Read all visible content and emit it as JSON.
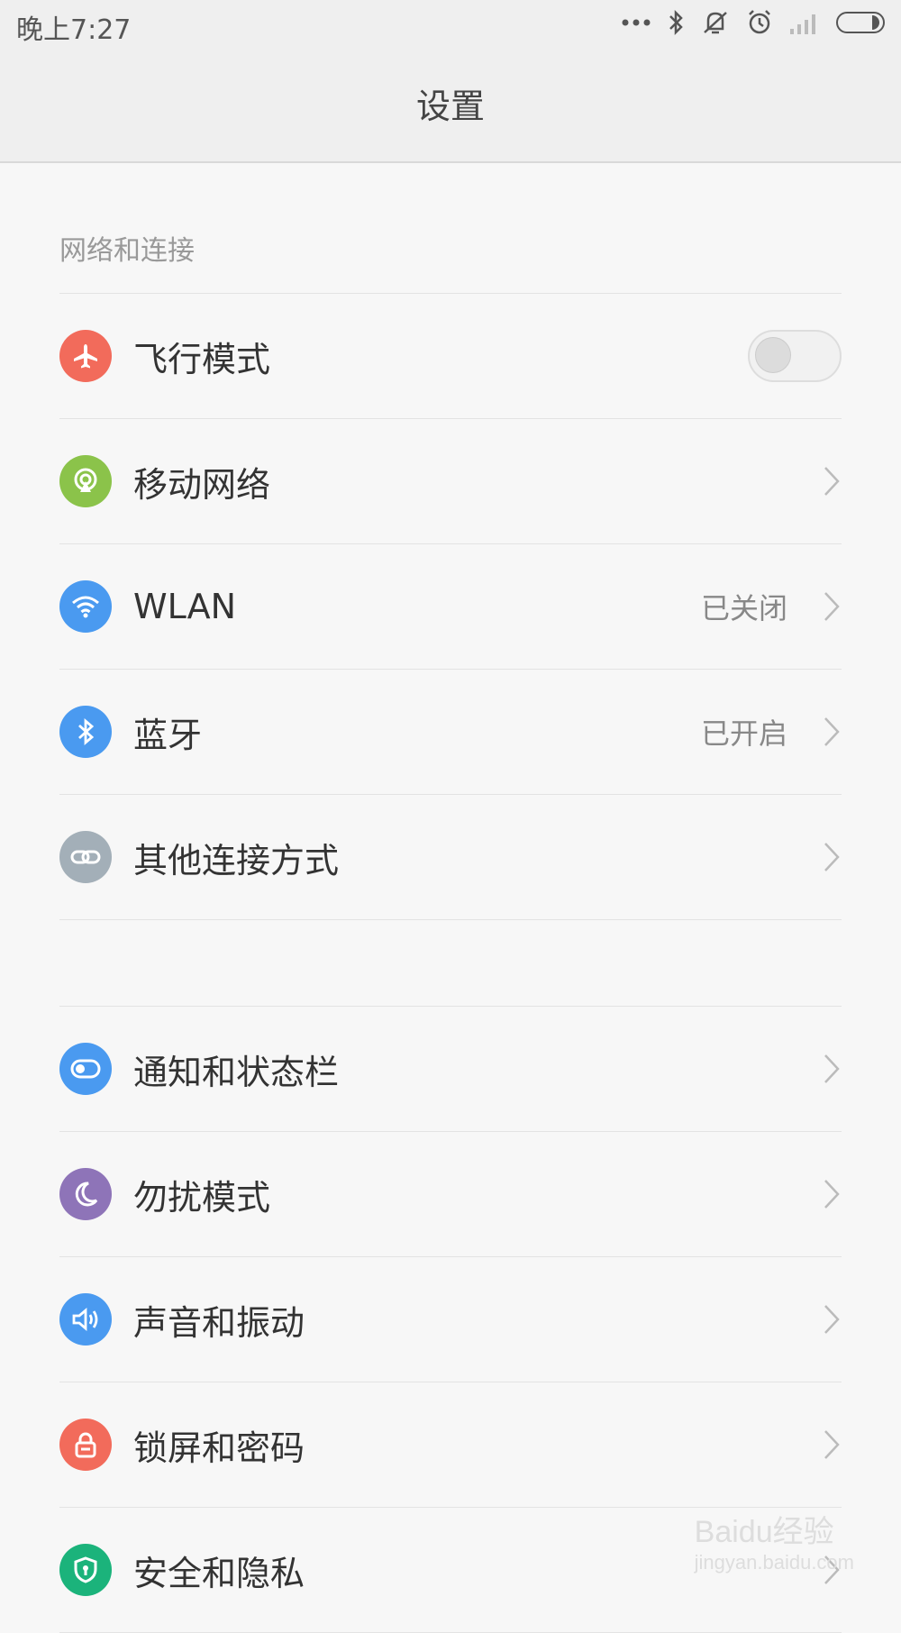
{
  "status_bar": {
    "time": "晚上7:27",
    "icons": [
      "dots-icon",
      "bluetooth-icon",
      "mute-icon",
      "alarm-icon",
      "signal-icon",
      "battery-icon"
    ]
  },
  "header": {
    "title": "设置"
  },
  "section1": {
    "title": "网络和连接",
    "items": [
      {
        "label": "飞行模式",
        "icon": "airplane-icon",
        "color": "#f26b5b",
        "toggle": "off"
      },
      {
        "label": "移动网络",
        "icon": "cellular-icon",
        "color": "#8bc34a"
      },
      {
        "label": "WLAN",
        "icon": "wifi-icon",
        "color": "#4a9af0",
        "value": "已关闭"
      },
      {
        "label": "蓝牙",
        "icon": "bluetooth-icon",
        "color": "#4a9af0",
        "value": "已开启"
      },
      {
        "label": "其他连接方式",
        "icon": "link-icon",
        "color": "#a3afb8"
      }
    ]
  },
  "section2": {
    "items": [
      {
        "label": "通知和状态栏",
        "icon": "toggle-icon",
        "color": "#4a9af0"
      },
      {
        "label": "勿扰模式",
        "icon": "moon-icon",
        "color": "#8e74b8"
      },
      {
        "label": "声音和振动",
        "icon": "speaker-icon",
        "color": "#4a9af0"
      },
      {
        "label": "锁屏和密码",
        "icon": "lock-icon",
        "color": "#f26b5b"
      },
      {
        "label": "安全和隐私",
        "icon": "shield-icon",
        "color": "#1bb37b"
      }
    ]
  },
  "watermark": {
    "brand": "Baidu经验",
    "url": "jingyan.baidu.com"
  }
}
